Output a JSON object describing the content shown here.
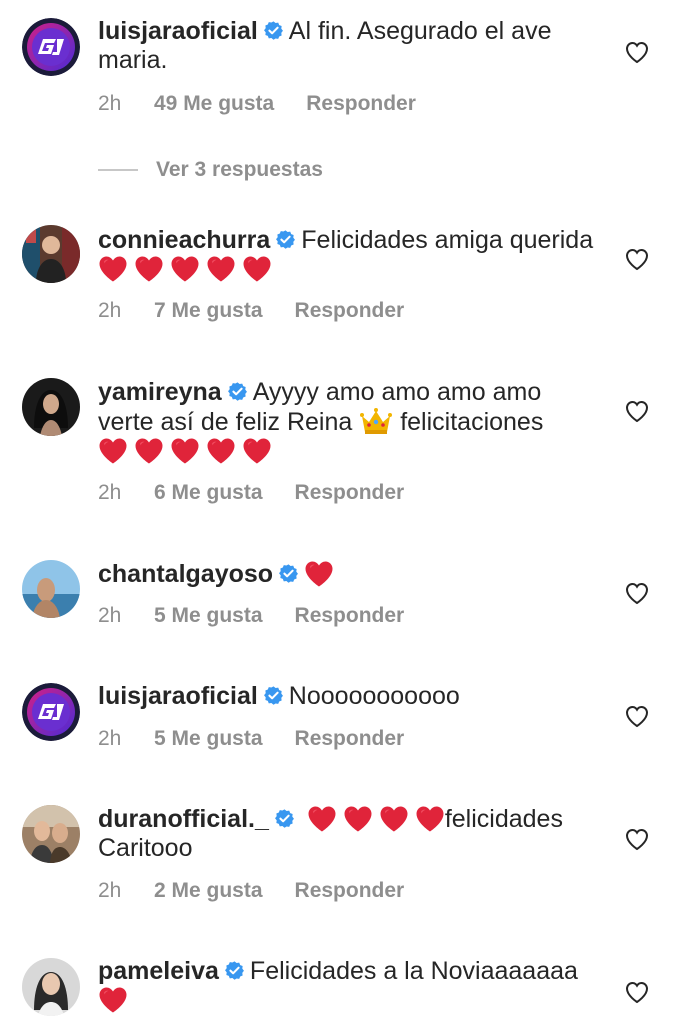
{
  "comments": [
    {
      "username": "luisjaraoficial",
      "text": "Al fin.  Asegurado el ave maria.",
      "time": "2h",
      "likes": "49 Me gusta",
      "reply": "Responder"
    },
    {
      "username": "connieachurra",
      "text": "Felicidades amiga querida",
      "time": "2h",
      "likes": "7 Me gusta",
      "reply": "Responder"
    },
    {
      "username": "yamireyna",
      "text": "Ayyyy amo amo amo amo verte así de feliz Reina",
      "text2": "felicitaciones",
      "time": "2h",
      "likes": "6 Me gusta",
      "reply": "Responder"
    },
    {
      "username": "chantalgayoso",
      "text": "",
      "time": "2h",
      "likes": "5 Me gusta",
      "reply": "Responder"
    },
    {
      "username": "luisjaraoficial",
      "text": "Nooooooooooo",
      "time": "2h",
      "likes": "5 Me gusta",
      "reply": "Responder"
    },
    {
      "username": "duranofficial._",
      "text": "felicidades Caritooo",
      "time": "2h",
      "likes": "2 Me gusta",
      "reply": "Responder"
    },
    {
      "username": "pameleiva",
      "text": "Felicidades a la Noviaaaaaaa",
      "time": "",
      "likes": "",
      "reply": ""
    }
  ],
  "view_replies": "Ver 3 respuestas",
  "colors": {
    "verified": "#3897f0",
    "meta": "#8e8e8e",
    "text": "#262626",
    "emoji_heart": "#e0243a"
  },
  "icons": {
    "like": "heart-outline-icon",
    "verified": "verified-badge-icon"
  }
}
